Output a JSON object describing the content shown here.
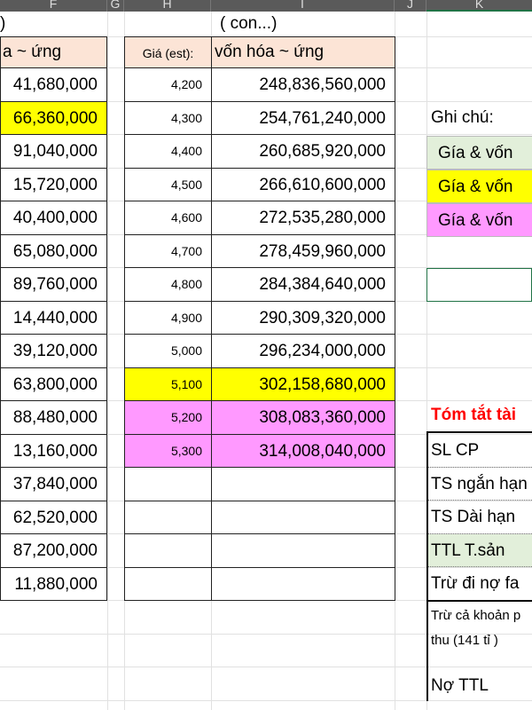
{
  "columns": [
    "F",
    "G",
    "H",
    "I",
    "J",
    "K"
  ],
  "title_left": ")",
  "title_right": "( con...)",
  "left_header": "a ~ ứng",
  "price_header": "Giá (est):",
  "cap_header": "vốn hóa ~ ứng",
  "left_values": [
    "41,680,000",
    "66,360,000",
    "91,040,000",
    "15,720,000",
    "40,400,000",
    "65,080,000",
    "89,760,000",
    "14,440,000",
    "39,120,000",
    "63,800,000",
    "88,480,000",
    "13,160,000",
    "37,840,000",
    "62,520,000",
    "87,200,000",
    "11,880,000"
  ],
  "left_highlight": [
    "",
    "yellow",
    "",
    "",
    "",
    "",
    "",
    "",
    "",
    "",
    "",
    "",
    "",
    "",
    "",
    ""
  ],
  "rows": [
    {
      "price": "4,200",
      "cap": "248,836,560,000",
      "hl": ""
    },
    {
      "price": "4,300",
      "cap": "254,761,240,000",
      "hl": ""
    },
    {
      "price": "4,400",
      "cap": "260,685,920,000",
      "hl": ""
    },
    {
      "price": "4,500",
      "cap": "266,610,600,000",
      "hl": ""
    },
    {
      "price": "4,600",
      "cap": "272,535,280,000",
      "hl": ""
    },
    {
      "price": "4,700",
      "cap": "278,459,960,000",
      "hl": ""
    },
    {
      "price": "4,800",
      "cap": "284,384,640,000",
      "hl": ""
    },
    {
      "price": "4,900",
      "cap": "290,309,320,000",
      "hl": ""
    },
    {
      "price": "5,000",
      "cap": "296,234,000,000",
      "hl": ""
    },
    {
      "price": "5,100",
      "cap": "302,158,680,000",
      "hl": "yellow"
    },
    {
      "price": "5,200",
      "cap": "308,083,360,000",
      "hl": "pink"
    },
    {
      "price": "5,300",
      "cap": "314,008,040,000",
      "hl": "pink"
    }
  ],
  "notes": {
    "label": "Ghi chú:",
    "items": [
      {
        "text": "Gía  & vốn",
        "color": "#e2efda"
      },
      {
        "text": "Gía  & vốn",
        "color": "#ffff00"
      },
      {
        "text": "Gía  & vốn",
        "color": "#ff99ff"
      }
    ]
  },
  "summary": {
    "title": "Tóm tắt tài",
    "title_color": "#ff0000",
    "items": [
      "SL CP",
      "TS ngắn hạn",
      "TS Dài hạn",
      "TTL T.sản",
      "Trừ đi nợ fa"
    ],
    "note_line1": "Trừ cả khoản p",
    "note_line2": "thu (141 tỉ )",
    "debt": "Nợ TTL"
  }
}
